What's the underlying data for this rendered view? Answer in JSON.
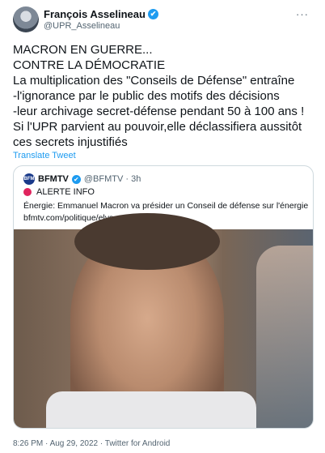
{
  "author": {
    "name": "François Asselineau",
    "handle": "@UPR_Asselineau",
    "verified_icon": "✔",
    "more_icon": "···"
  },
  "tweet": {
    "lines": [
      "MACRON EN GUERRE...",
      "CONTRE LA DÉMOCRATIE",
      "La multiplication des \"Conseils de Défense\" entraîne",
      "-l'ignorance par le public des motifs des décisions",
      "-leur archivage secret-défense pendant 50 à 100 ans !",
      "Si l'UPR parvient au pouvoir,elle déclassifiera aussitôt",
      "ces secrets injustifiés"
    ],
    "translate": "Translate Tweet"
  },
  "quote": {
    "logo_text": "BFM",
    "name": "BFMTV",
    "verified_icon": "✔",
    "meta": "@BFMTV · 3h",
    "alert": "ALERTE INFO",
    "body_line1": "Énergie: Emmanuel Macron va présider un Conseil de défense sur l'énergie",
    "body_line2": "bfmtv.com/politique/elys..."
  },
  "footer": {
    "timestamp": "8:26 PM · Aug 29, 2022 · Twitter for Android"
  },
  "colors": {
    "accent": "#1d9bf0",
    "alert": "#e0245e",
    "secondary_text": "#536471"
  }
}
